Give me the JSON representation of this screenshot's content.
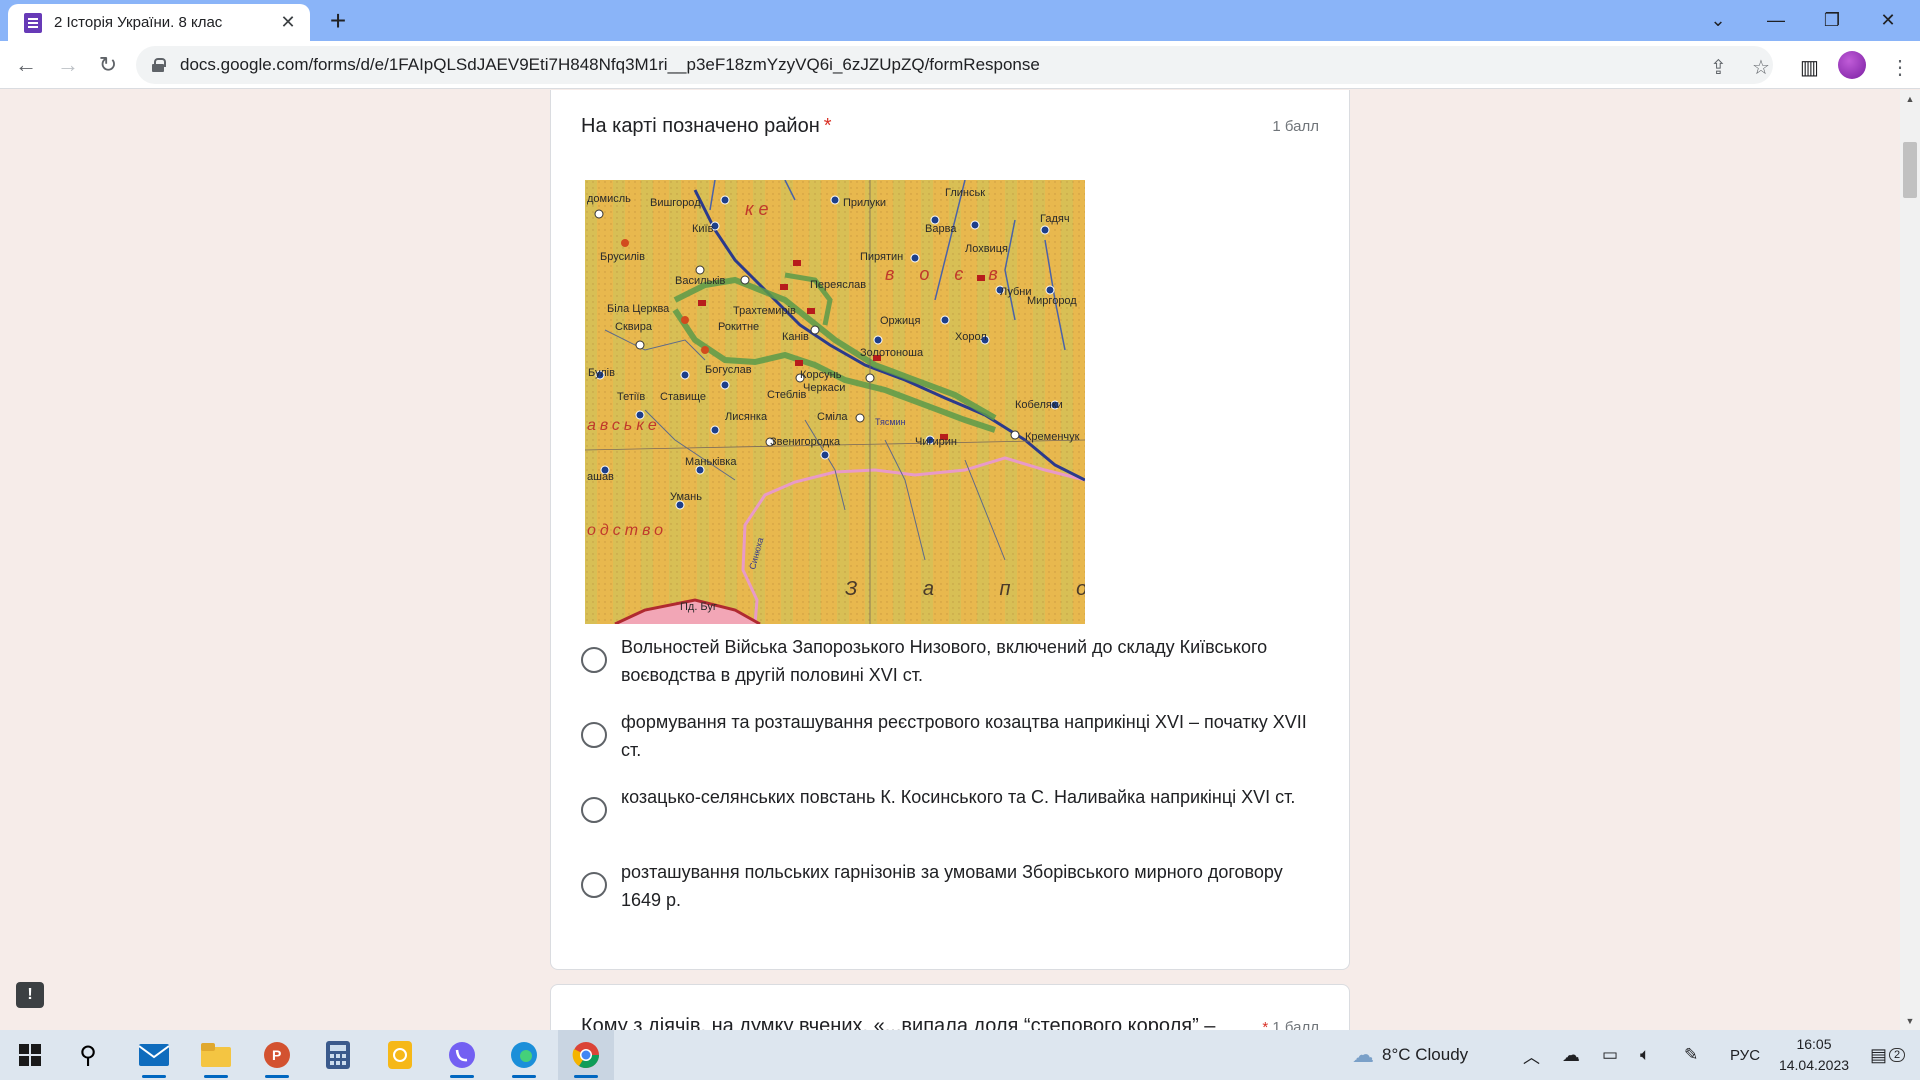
{
  "browser": {
    "tab_title": "2 Історія України. 8 клас",
    "url": "docs.google.com/forms/d/e/1FAIpQLSdJAEV9Eti7H848Nfq3M1ri__p3eF18zmYzyVQ6i_6zJZUpZQ/formResponse"
  },
  "question1": {
    "title": "На карті позначено район",
    "required_mark": "*",
    "points": "1 балл",
    "options": [
      "Вольностей Війська Запорозького Низового, включений до складу Київського воєводства в другій половині XVI ст.",
      "формування та розташування реєстрового козацтва наприкінці XVI – початку XVII ст.",
      "козацько-селянських повстань К. Косинського та С. Наливайка наприкінці XVI ст.",
      "розташування польських гарнізонів за умовами Зборівського мирного договору 1649 р."
    ],
    "map": {
      "labels": [
        "Вишгород",
        "Київ",
        "Прилуки",
        "Глинськ",
        "Гадяч",
        "Варва",
        "Лохвиця",
        "Брусилів",
        "Васильків",
        "Пирятин",
        "Переяслав",
        "Лубни",
        "Миргород",
        "Біла Церква",
        "Трахтемирів",
        "Сквира",
        "Рокитне",
        "Канів",
        "Оржиця",
        "Хорол",
        "Богуслав",
        "Золотоноша",
        "Корсунь",
        "Черкаси",
        "Стеблів",
        "Ставище",
        "Тетіїв",
        "Лисянка",
        "Сміла",
        "Кременчук",
        "Кобеляки",
        "Звенигородка",
        "Чигирин",
        "Маньківка",
        "Умань",
        "Тясмин",
        "Синюха",
        "Пд. Буг",
        "З а п о",
        "авське",
        "одство",
        "к е",
        "в о є в",
        "домисль",
        "Булів",
        "ашав"
      ]
    }
  },
  "question2": {
    "title": "Кому з діячів, на думку вчених, «...випала доля “степового короля” –",
    "required_mark": "*",
    "points": "1 балл"
  },
  "taskbar": {
    "weather": "8°C  Cloudy",
    "language": "РУС",
    "time": "16:05",
    "date": "14.04.2023",
    "notifications": "2"
  },
  "colors": {
    "tabbar": "#8ab4f8",
    "form_bg": "#f6ece9",
    "required": "#d93025",
    "forms_purple": "#673ab7"
  }
}
